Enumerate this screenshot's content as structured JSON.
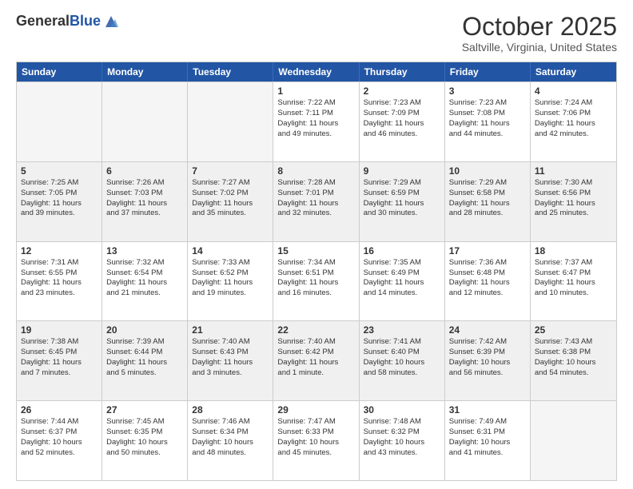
{
  "header": {
    "logo_general": "General",
    "logo_blue": "Blue",
    "month_title": "October 2025",
    "location": "Saltville, Virginia, United States"
  },
  "days_of_week": [
    "Sunday",
    "Monday",
    "Tuesday",
    "Wednesday",
    "Thursday",
    "Friday",
    "Saturday"
  ],
  "weeks": [
    [
      {
        "day": "",
        "info": "",
        "shaded": true,
        "empty": true
      },
      {
        "day": "",
        "info": "",
        "shaded": true,
        "empty": true
      },
      {
        "day": "",
        "info": "",
        "shaded": true,
        "empty": true
      },
      {
        "day": "1",
        "info": "Sunrise: 7:22 AM\nSunset: 7:11 PM\nDaylight: 11 hours\nand 49 minutes.",
        "shaded": false,
        "empty": false
      },
      {
        "day": "2",
        "info": "Sunrise: 7:23 AM\nSunset: 7:09 PM\nDaylight: 11 hours\nand 46 minutes.",
        "shaded": false,
        "empty": false
      },
      {
        "day": "3",
        "info": "Sunrise: 7:23 AM\nSunset: 7:08 PM\nDaylight: 11 hours\nand 44 minutes.",
        "shaded": false,
        "empty": false
      },
      {
        "day": "4",
        "info": "Sunrise: 7:24 AM\nSunset: 7:06 PM\nDaylight: 11 hours\nand 42 minutes.",
        "shaded": false,
        "empty": false
      }
    ],
    [
      {
        "day": "5",
        "info": "Sunrise: 7:25 AM\nSunset: 7:05 PM\nDaylight: 11 hours\nand 39 minutes.",
        "shaded": true,
        "empty": false
      },
      {
        "day": "6",
        "info": "Sunrise: 7:26 AM\nSunset: 7:03 PM\nDaylight: 11 hours\nand 37 minutes.",
        "shaded": true,
        "empty": false
      },
      {
        "day": "7",
        "info": "Sunrise: 7:27 AM\nSunset: 7:02 PM\nDaylight: 11 hours\nand 35 minutes.",
        "shaded": true,
        "empty": false
      },
      {
        "day": "8",
        "info": "Sunrise: 7:28 AM\nSunset: 7:01 PM\nDaylight: 11 hours\nand 32 minutes.",
        "shaded": true,
        "empty": false
      },
      {
        "day": "9",
        "info": "Sunrise: 7:29 AM\nSunset: 6:59 PM\nDaylight: 11 hours\nand 30 minutes.",
        "shaded": true,
        "empty": false
      },
      {
        "day": "10",
        "info": "Sunrise: 7:29 AM\nSunset: 6:58 PM\nDaylight: 11 hours\nand 28 minutes.",
        "shaded": true,
        "empty": false
      },
      {
        "day": "11",
        "info": "Sunrise: 7:30 AM\nSunset: 6:56 PM\nDaylight: 11 hours\nand 25 minutes.",
        "shaded": true,
        "empty": false
      }
    ],
    [
      {
        "day": "12",
        "info": "Sunrise: 7:31 AM\nSunset: 6:55 PM\nDaylight: 11 hours\nand 23 minutes.",
        "shaded": false,
        "empty": false
      },
      {
        "day": "13",
        "info": "Sunrise: 7:32 AM\nSunset: 6:54 PM\nDaylight: 11 hours\nand 21 minutes.",
        "shaded": false,
        "empty": false
      },
      {
        "day": "14",
        "info": "Sunrise: 7:33 AM\nSunset: 6:52 PM\nDaylight: 11 hours\nand 19 minutes.",
        "shaded": false,
        "empty": false
      },
      {
        "day": "15",
        "info": "Sunrise: 7:34 AM\nSunset: 6:51 PM\nDaylight: 11 hours\nand 16 minutes.",
        "shaded": false,
        "empty": false
      },
      {
        "day": "16",
        "info": "Sunrise: 7:35 AM\nSunset: 6:49 PM\nDaylight: 11 hours\nand 14 minutes.",
        "shaded": false,
        "empty": false
      },
      {
        "day": "17",
        "info": "Sunrise: 7:36 AM\nSunset: 6:48 PM\nDaylight: 11 hours\nand 12 minutes.",
        "shaded": false,
        "empty": false
      },
      {
        "day": "18",
        "info": "Sunrise: 7:37 AM\nSunset: 6:47 PM\nDaylight: 11 hours\nand 10 minutes.",
        "shaded": false,
        "empty": false
      }
    ],
    [
      {
        "day": "19",
        "info": "Sunrise: 7:38 AM\nSunset: 6:45 PM\nDaylight: 11 hours\nand 7 minutes.",
        "shaded": true,
        "empty": false
      },
      {
        "day": "20",
        "info": "Sunrise: 7:39 AM\nSunset: 6:44 PM\nDaylight: 11 hours\nand 5 minutes.",
        "shaded": true,
        "empty": false
      },
      {
        "day": "21",
        "info": "Sunrise: 7:40 AM\nSunset: 6:43 PM\nDaylight: 11 hours\nand 3 minutes.",
        "shaded": true,
        "empty": false
      },
      {
        "day": "22",
        "info": "Sunrise: 7:40 AM\nSunset: 6:42 PM\nDaylight: 11 hours\nand 1 minute.",
        "shaded": true,
        "empty": false
      },
      {
        "day": "23",
        "info": "Sunrise: 7:41 AM\nSunset: 6:40 PM\nDaylight: 10 hours\nand 58 minutes.",
        "shaded": true,
        "empty": false
      },
      {
        "day": "24",
        "info": "Sunrise: 7:42 AM\nSunset: 6:39 PM\nDaylight: 10 hours\nand 56 minutes.",
        "shaded": true,
        "empty": false
      },
      {
        "day": "25",
        "info": "Sunrise: 7:43 AM\nSunset: 6:38 PM\nDaylight: 10 hours\nand 54 minutes.",
        "shaded": true,
        "empty": false
      }
    ],
    [
      {
        "day": "26",
        "info": "Sunrise: 7:44 AM\nSunset: 6:37 PM\nDaylight: 10 hours\nand 52 minutes.",
        "shaded": false,
        "empty": false
      },
      {
        "day": "27",
        "info": "Sunrise: 7:45 AM\nSunset: 6:35 PM\nDaylight: 10 hours\nand 50 minutes.",
        "shaded": false,
        "empty": false
      },
      {
        "day": "28",
        "info": "Sunrise: 7:46 AM\nSunset: 6:34 PM\nDaylight: 10 hours\nand 48 minutes.",
        "shaded": false,
        "empty": false
      },
      {
        "day": "29",
        "info": "Sunrise: 7:47 AM\nSunset: 6:33 PM\nDaylight: 10 hours\nand 45 minutes.",
        "shaded": false,
        "empty": false
      },
      {
        "day": "30",
        "info": "Sunrise: 7:48 AM\nSunset: 6:32 PM\nDaylight: 10 hours\nand 43 minutes.",
        "shaded": false,
        "empty": false
      },
      {
        "day": "31",
        "info": "Sunrise: 7:49 AM\nSunset: 6:31 PM\nDaylight: 10 hours\nand 41 minutes.",
        "shaded": false,
        "empty": false
      },
      {
        "day": "",
        "info": "",
        "shaded": false,
        "empty": true
      }
    ]
  ]
}
